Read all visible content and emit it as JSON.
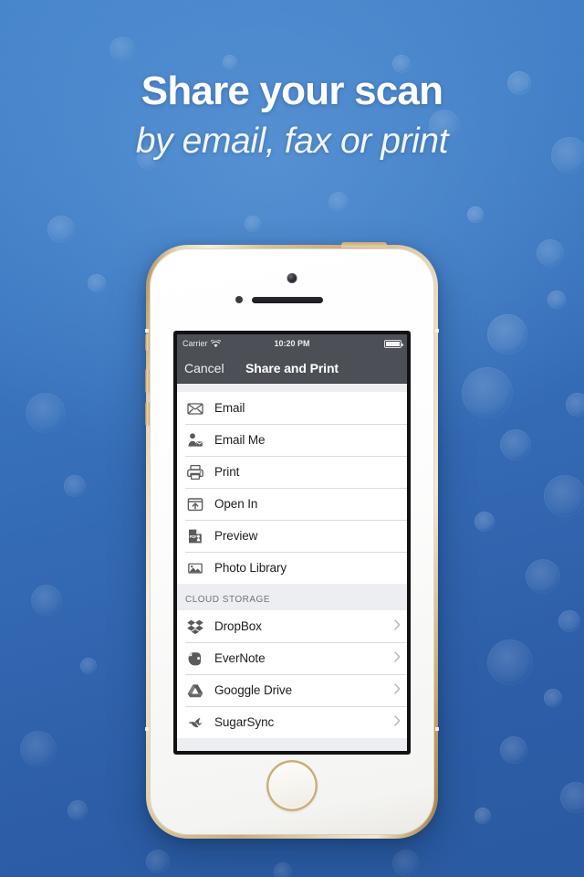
{
  "promo": {
    "headline": "Share your scan",
    "subheadline": "by email, fax or print",
    "background_top_color": "#4584cb",
    "background_bottom_color": "#2a5aa1",
    "headline_color": "#ffffff"
  },
  "device": {
    "name": "iphone-5s-gold",
    "body_color": "#d9c193",
    "face_color": "#ffffff"
  },
  "screen": {
    "statusbar": {
      "carrier": "Carrier",
      "wifi_icon": "wifi-icon",
      "time": "10:20 PM",
      "battery_icon": "battery-full-icon",
      "background_color": "#4c4f56"
    },
    "navbar": {
      "cancel_label": "Cancel",
      "title": "Share and Print",
      "background_color": "#4c4f56",
      "title_color": "#ffffff"
    },
    "share_section": {
      "rows": [
        {
          "label": "Email",
          "icon": "envelope-icon",
          "chevron": false
        },
        {
          "label": "Email Me",
          "icon": "contact-card-icon",
          "chevron": false
        },
        {
          "label": "Print",
          "icon": "printer-icon",
          "chevron": false
        },
        {
          "label": "Open In",
          "icon": "open-in-icon",
          "chevron": false
        },
        {
          "label": "Preview",
          "icon": "pdf-document-icon",
          "chevron": false
        },
        {
          "label": "Photo Library",
          "icon": "photo-icon",
          "chevron": false
        }
      ]
    },
    "cloud_section": {
      "header": "CLOUD STORAGE",
      "rows": [
        {
          "label": "DropBox",
          "icon": "dropbox-icon",
          "chevron": true
        },
        {
          "label": "EverNote",
          "icon": "evernote-icon",
          "chevron": true
        },
        {
          "label": "Googgle Drive",
          "icon": "googledrive-icon",
          "chevron": true
        },
        {
          "label": "SugarSync",
          "icon": "sugarsync-icon",
          "chevron": true
        }
      ]
    },
    "row_text_color": "#1d1d1f",
    "icon_color": "#5a5a5e",
    "separator_color": "#dcdcdc",
    "group_background": "#eceef1"
  }
}
